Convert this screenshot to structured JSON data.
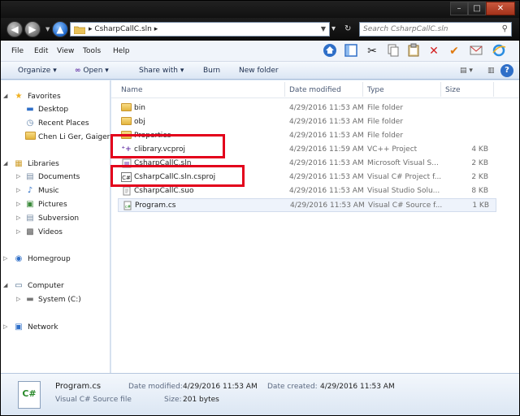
{
  "address": {
    "breadcrumb": "CsharpCallC.sln",
    "search_placeholder": "Search CsharpCallC.sln"
  },
  "menu": [
    "File",
    "Edit",
    "View",
    "Tools",
    "Help"
  ],
  "toolbar_icons": [
    "home-icon",
    "view-pane-icon",
    "cut-icon",
    "copy-icon",
    "paste-icon",
    "delete-icon",
    "checkmark-icon",
    "mail-icon",
    "ie-icon"
  ],
  "commands": {
    "organize": "Organize",
    "open": "Open",
    "share_with": "Share with",
    "burn": "Burn",
    "new_folder": "New folder"
  },
  "nav": {
    "favorites": "Favorites",
    "desktop": "Desktop",
    "recent_places": "Recent Places",
    "user": "Chen Li Ger, Gaiger",
    "libraries": "Libraries",
    "documents": "Documents",
    "music": "Music",
    "pictures": "Pictures",
    "subversion": "Subversion",
    "videos": "Videos",
    "homegroup": "Homegroup",
    "computer": "Computer",
    "system_c": "System (C:)",
    "network": "Network"
  },
  "columns": {
    "name": "Name",
    "date": "Date modified",
    "type": "Type",
    "size": "Size"
  },
  "files": [
    {
      "name": "bin",
      "date": "4/29/2016 11:53 AM",
      "type": "File folder",
      "size": "",
      "icon": "folder-icon"
    },
    {
      "name": "obj",
      "date": "4/29/2016 11:53 AM",
      "type": "File folder",
      "size": "",
      "icon": "folder-icon"
    },
    {
      "name": "Properties",
      "date": "4/29/2016 11:53 AM",
      "type": "File folder",
      "size": "",
      "icon": "folder-icon"
    },
    {
      "name": "clibrary.vcproj",
      "date": "4/29/2016 11:59 AM",
      "type": "VC++ Project",
      "size": "4 KB",
      "icon": "vcproj-icon"
    },
    {
      "name": "CsharpCallC.sln",
      "date": "4/29/2016 11:53 AM",
      "type": "Microsoft Visual S...",
      "size": "2 KB",
      "icon": "sln-icon"
    },
    {
      "name": "CsharpCallC.sln.csproj",
      "date": "4/29/2016 11:53 AM",
      "type": "Visual C# Project f...",
      "size": "2 KB",
      "icon": "csproj-icon"
    },
    {
      "name": "CsharpCallC.suo",
      "date": "4/29/2016 11:53 AM",
      "type": "Visual Studio Solu...",
      "size": "8 KB",
      "icon": "suo-icon"
    },
    {
      "name": "Program.cs",
      "date": "4/29/2016 11:53 AM",
      "type": "Visual C# Source f...",
      "size": "1 KB",
      "icon": "cs-file-icon"
    }
  ],
  "details": {
    "file_name": "Program.cs",
    "file_type": "Visual C# Source file",
    "date_modified_label": "Date modified:",
    "date_modified": "4/29/2016 11:53 AM",
    "date_created_label": "Date created:",
    "date_created": "4/29/2016 11:53 AM",
    "size_label": "Size:",
    "size": "201 bytes",
    "icon_text": "C#"
  },
  "colors": {
    "annotation": "#e3001b",
    "selection": "#dceafb",
    "titlebar": "#111111"
  }
}
